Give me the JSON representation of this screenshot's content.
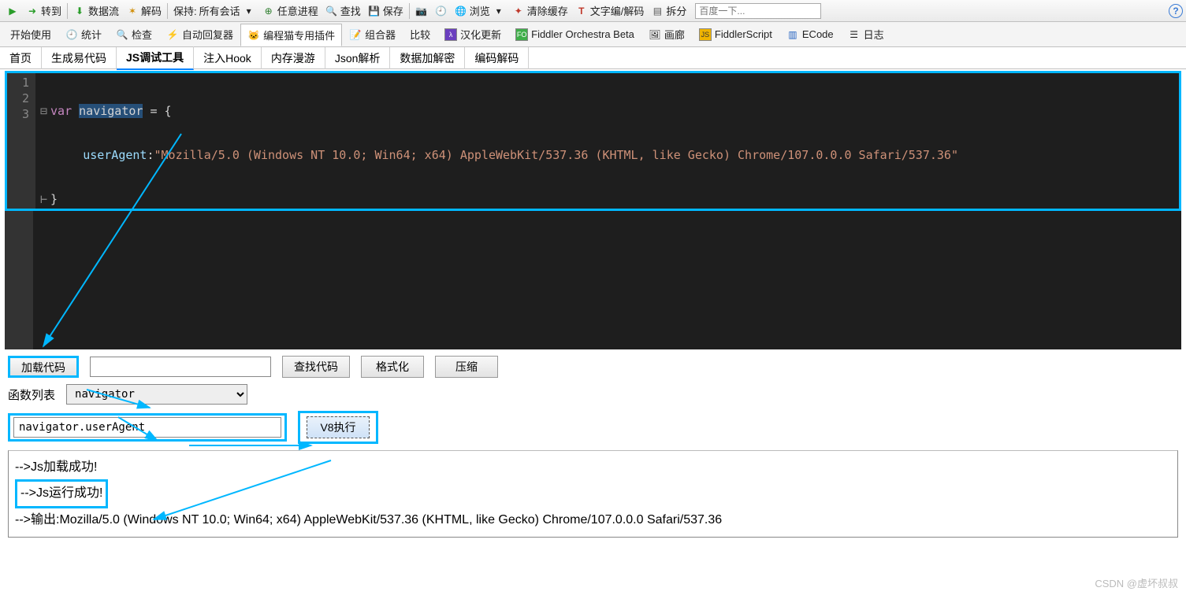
{
  "toolbar": {
    "goto": "转到",
    "dataflow": "数据流",
    "decode": "解码",
    "keep_label": "保持:",
    "keep_value": "所有会话",
    "any_process": "任意进程",
    "find": "查找",
    "save": "保存",
    "browse": "浏览",
    "clear_cache": "清除缓存",
    "text_codec": "文字编/解码",
    "split": "拆分",
    "search_placeholder": "百度一下..."
  },
  "tabs": {
    "start": "开始使用",
    "stats": "统计",
    "inspect": "检查",
    "autoresponder": "自动回复器",
    "catplugin": "编程猫专用插件",
    "composer": "组合器",
    "compare": "比较",
    "sinicize": "汉化更新",
    "orchestra": "Fiddler Orchestra Beta",
    "gallery": "画廊",
    "fiddlerscript": "FiddlerScript",
    "ecode": "ECode",
    "log": "日志"
  },
  "subtabs": {
    "home": "首页",
    "gencode": "生成易代码",
    "jsdebug": "JS调试工具",
    "hook": "注入Hook",
    "memwalk": "内存漫游",
    "jsonparse": "Json解析",
    "crypto": "数据加解密",
    "codec": "编码解码"
  },
  "code": {
    "ln1": "1",
    "ln2": "2",
    "ln3": "3",
    "line1_var": "var ",
    "line1_name": "navigator",
    "line1_eq": " = {",
    "line2_prop": "userAgent",
    "line2_colon": ":",
    "line2_str": "\"Mozilla/5.0 (Windows NT 10.0; Win64; x64) AppleWebKit/537.36 (KHTML, like Gecko) Chrome/107.0.0.0 Safari/537.36\"",
    "line3": "}"
  },
  "panel": {
    "load_code": "加载代码",
    "find_code": "查找代码",
    "format": "格式化",
    "compress": "压缩",
    "func_list": "函数列表",
    "combo_value": "navigator",
    "expr_value": "navigator.userAgent",
    "v8_run": "V8执行"
  },
  "output": {
    "line1": "-->Js加载成功!",
    "line2": "-->Js运行成功!",
    "line3": "-->输出:Mozilla/5.0 (Windows NT 10.0; Win64; x64) AppleWebKit/537.36 (KHTML, like Gecko) Chrome/107.0.0.0 Safari/537.36"
  },
  "watermark": "CSDN @虚坏叔叔"
}
